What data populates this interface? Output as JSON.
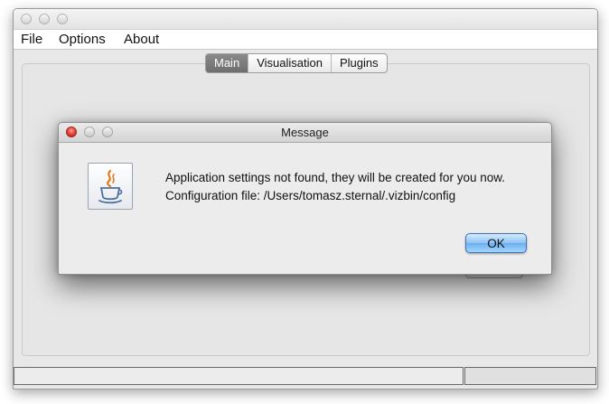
{
  "window": {
    "menu": [
      "File",
      "Options",
      "About"
    ],
    "tabs": [
      {
        "label": "Main",
        "active": true
      },
      {
        "label": "Visualisation",
        "active": false
      },
      {
        "label": "Plugins",
        "active": false
      }
    ]
  },
  "dialog": {
    "title": "Message",
    "message_line1": "Application settings not found, they will be created for you now.",
    "message_line2": "Configuration file: /Users/tomasz.sternal/.vizbin/config",
    "ok_label": "OK",
    "icon": "java-coffee-icon"
  },
  "colors": {
    "close_button": "#d3281d",
    "ok_button": "#8cc2f4"
  }
}
